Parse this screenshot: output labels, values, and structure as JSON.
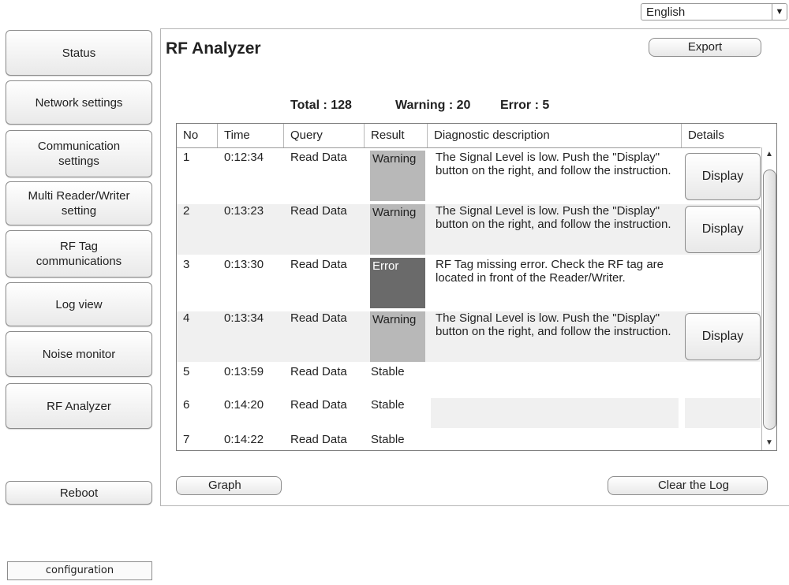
{
  "language": {
    "selected": "English"
  },
  "sidebar": {
    "items": [
      {
        "label": "Status"
      },
      {
        "label": "Network settings"
      },
      {
        "label": "Communication settings"
      },
      {
        "label": "Multi Reader/Writer setting"
      },
      {
        "label": "RF Tag communications"
      },
      {
        "label": "Log view"
      },
      {
        "label": "Noise monitor"
      },
      {
        "label": "RF Analyzer"
      }
    ],
    "reboot": "Reboot",
    "configuration": "configuration"
  },
  "main": {
    "title": "RF Analyzer",
    "export": "Export",
    "summary": {
      "total": "Total : 128",
      "warning": "Warning : 20",
      "error": "Error : 5"
    },
    "columns": [
      "No",
      "Time",
      "Query",
      "Result",
      "Diagnostic description",
      "Details"
    ],
    "rows": [
      {
        "no": "1",
        "time": "0:12:34",
        "query": "Read Data",
        "result": "Warning",
        "desc": "The Signal Level is low. Push the \"Display\" button on the right, and follow the instruction.",
        "details": "Display"
      },
      {
        "no": "2",
        "time": "0:13:23",
        "query": "Read Data",
        "result": "Warning",
        "desc": "The Signal Level is low. Push the \"Display\" button on the right, and follow the instruction.",
        "details": "Display"
      },
      {
        "no": "3",
        "time": "0:13:30",
        "query": "Read Data",
        "result": "Error",
        "desc": "RF Tag missing error. Check the RF tag are located in front of the Reader/Writer.",
        "details": ""
      },
      {
        "no": "4",
        "time": "0:13:34",
        "query": "Read Data",
        "result": "Warning",
        "desc": "The Signal Level is low. Push the \"Display\" button on the right, and follow the instruction.",
        "details": "Display"
      },
      {
        "no": "5",
        "time": "0:13:59",
        "query": "Read Data",
        "result": "Stable",
        "desc": "",
        "details": ""
      },
      {
        "no": "6",
        "time": "0:14:20",
        "query": "Read Data",
        "result": "Stable",
        "desc": "",
        "details": ""
      },
      {
        "no": "7",
        "time": "0:14:22",
        "query": "Read Data",
        "result": "Stable",
        "desc": "",
        "details": ""
      }
    ],
    "graph": "Graph",
    "clear_log": "Clear the Log"
  },
  "colors": {
    "warning": "#b8b8b8",
    "error": "#6a6a6a",
    "row_shade": "#f0f0f0"
  }
}
